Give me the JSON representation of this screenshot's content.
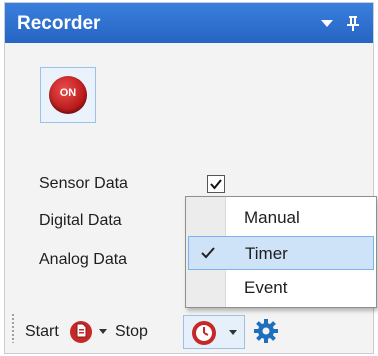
{
  "window": {
    "title": "Recorder"
  },
  "toggle": {
    "label": "ON",
    "state": "on"
  },
  "data_options": [
    {
      "label": "Sensor Data",
      "checked": true
    },
    {
      "label": "Digital Data"
    },
    {
      "label": "Analog Data"
    }
  ],
  "trigger_menu": {
    "items": [
      {
        "label": "Manual",
        "checked": false
      },
      {
        "label": "Timer",
        "checked": true
      },
      {
        "label": "Event",
        "checked": false
      }
    ]
  },
  "toolbar": {
    "start_label": "Start",
    "stop_label": "Stop"
  },
  "icons": {
    "menu": "dropdown-arrow-icon",
    "pin": "pin-icon",
    "power": "power-on-icon",
    "start": "start-trigger-icon",
    "stop": "timer-icon",
    "settings": "gear-icon"
  },
  "colors": {
    "title_bar": "#2c6fcf",
    "accent_red": "#c62828",
    "selection": "#cfe3f8",
    "gear": "#1f6fbf"
  }
}
